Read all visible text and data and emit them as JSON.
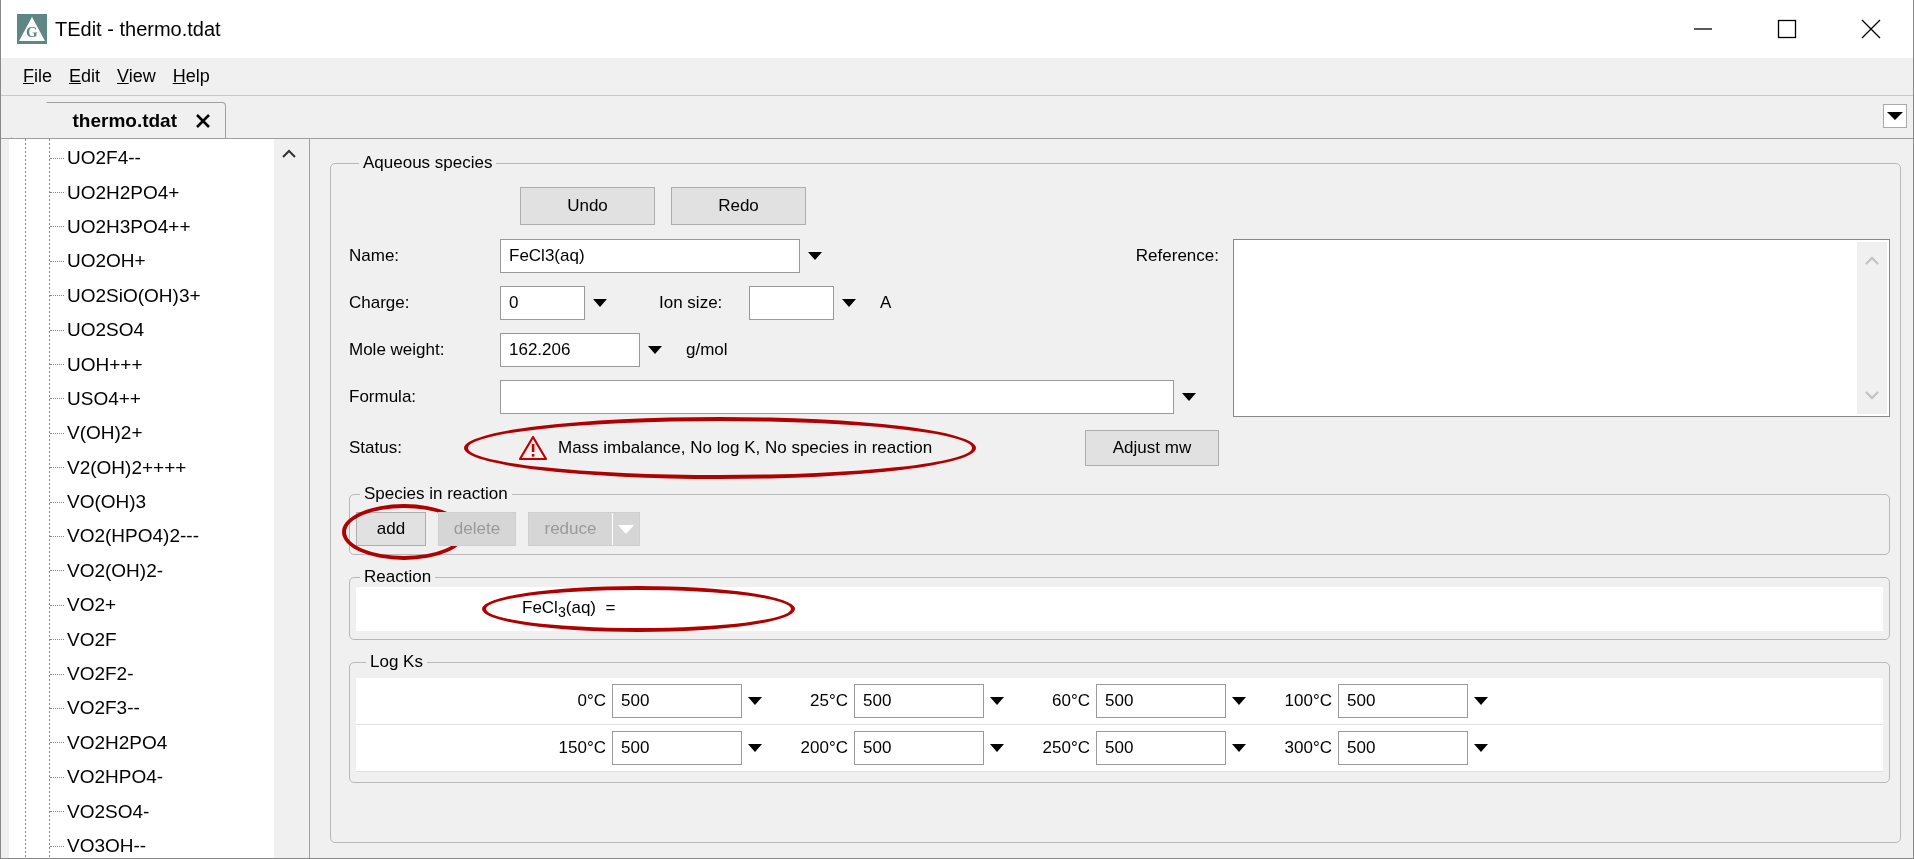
{
  "window": {
    "title": "TEdit - thermo.tdat",
    "icon_letter": "G"
  },
  "menu": [
    {
      "label": "File"
    },
    {
      "label": "Edit"
    },
    {
      "label": "View"
    },
    {
      "label": "Help"
    }
  ],
  "tabs": [
    {
      "label": "thermo.tdat",
      "selected": true
    }
  ],
  "tree": {
    "items": [
      "UO2F4--",
      "UO2H2PO4+",
      "UO2H3PO4++",
      "UO2OH+",
      "UO2SiO(OH)3+",
      "UO2SO4",
      "UOH+++",
      "USO4++",
      "V(OH)2+",
      "V2(OH)2++++",
      "VO(OH)3",
      "VO2(HPO4)2---",
      "VO2(OH)2-",
      "VO2+",
      "VO2F",
      "VO2F2-",
      "VO2F3--",
      "VO2H2PO4",
      "VO2HPO4-",
      "VO2SO4-",
      "VO3OH--"
    ]
  },
  "form": {
    "title": "Aqueous species",
    "undo": "Undo",
    "redo": "Redo",
    "name": {
      "label": "Name:",
      "value": "FeCl3(aq)"
    },
    "reference": {
      "label": "Reference:"
    },
    "charge": {
      "label": "Charge:",
      "value": "0"
    },
    "ion_size": {
      "label": "Ion size:",
      "unit": "A"
    },
    "mole_weight": {
      "label": "Mole weight:",
      "value": "162.206",
      "unit": "g/mol"
    },
    "formula": {
      "label": "Formula:"
    },
    "status": {
      "label": "Status:",
      "text": "Mass imbalance, No log K, No species in reaction",
      "highlighted": true
    },
    "adjust_button": "Adjust mw"
  },
  "species_in_reaction": {
    "title": "Species in reaction",
    "buttons": [
      {
        "label": "add",
        "kind": "plain",
        "disabled": false,
        "highlighted": true
      },
      {
        "label": "delete",
        "kind": "plain",
        "disabled": true,
        "highlighted": false
      },
      {
        "label": "reduce",
        "kind": "split",
        "disabled": true,
        "highlighted": false
      }
    ]
  },
  "reaction": {
    "title": "Reaction",
    "equation": "FeCl$_{3}$(aq)  =",
    "highlighted": true
  },
  "log_ks": {
    "title": "Log Ks",
    "rows": [
      [
        {
          "temp": "0°C",
          "value": "500"
        },
        {
          "temp": "25°C",
          "value": "500"
        },
        {
          "temp": "60°C",
          "value": "500"
        },
        {
          "temp": "100°C",
          "value": "500"
        }
      ],
      [
        {
          "temp": "150°C",
          "value": "500"
        },
        {
          "temp": "200°C",
          "value": "500"
        },
        {
          "temp": "250°C",
          "value": "500"
        },
        {
          "temp": "300°C",
          "value": "500"
        }
      ]
    ]
  }
}
